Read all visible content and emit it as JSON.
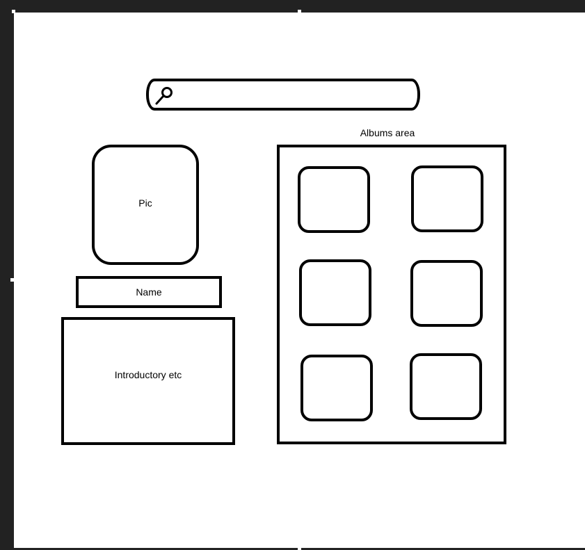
{
  "search": {
    "icon": "search-icon",
    "value": ""
  },
  "profile": {
    "pic_label": "Pic",
    "name_label": "Name",
    "intro_label": "Introductory etc"
  },
  "albums": {
    "label": "Albums area",
    "tiles": [
      "",
      "",
      "",
      "",
      "",
      ""
    ]
  },
  "colors": {
    "frame": "#222222",
    "canvas": "#ffffff",
    "stroke": "#000000"
  }
}
